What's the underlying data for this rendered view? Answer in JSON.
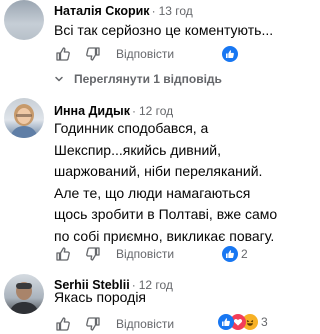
{
  "comments": [
    {
      "author": "Наталія Скорик",
      "time": "13 год",
      "text": "Всі так серйозно це коментують...",
      "reply_label": "Відповісти",
      "reaction_count": "",
      "view_replies_label": "Переглянути 1 відповідь"
    },
    {
      "author": "Инна Дидык",
      "time": "12 год",
      "text": "Годинник сподобався, а\nШекспир...якийсь дивний,\nшаржований, ніби переляканий.\nАле те, що люди намагаються\nщось зробити в Полтаві, вже само\nпо собі приємно, викликає повагу.",
      "reply_label": "Відповісти",
      "reaction_count": "2"
    },
    {
      "author": "Serhii Steblii",
      "time": "12 год",
      "text": "Якась породія",
      "reply_label": "Відповісти",
      "reaction_count": "3"
    }
  ],
  "colors": {
    "like_blue": "#1877f2",
    "love_red": "#f33e58",
    "haha_yellow": "#f7b125",
    "meta_grey": "#65676b"
  },
  "icons": [
    "thumbs-up-outline-icon",
    "thumbs-down-outline-icon",
    "chevron-down-icon",
    "like-reaction-icon",
    "love-reaction-icon",
    "haha-reaction-icon"
  ]
}
